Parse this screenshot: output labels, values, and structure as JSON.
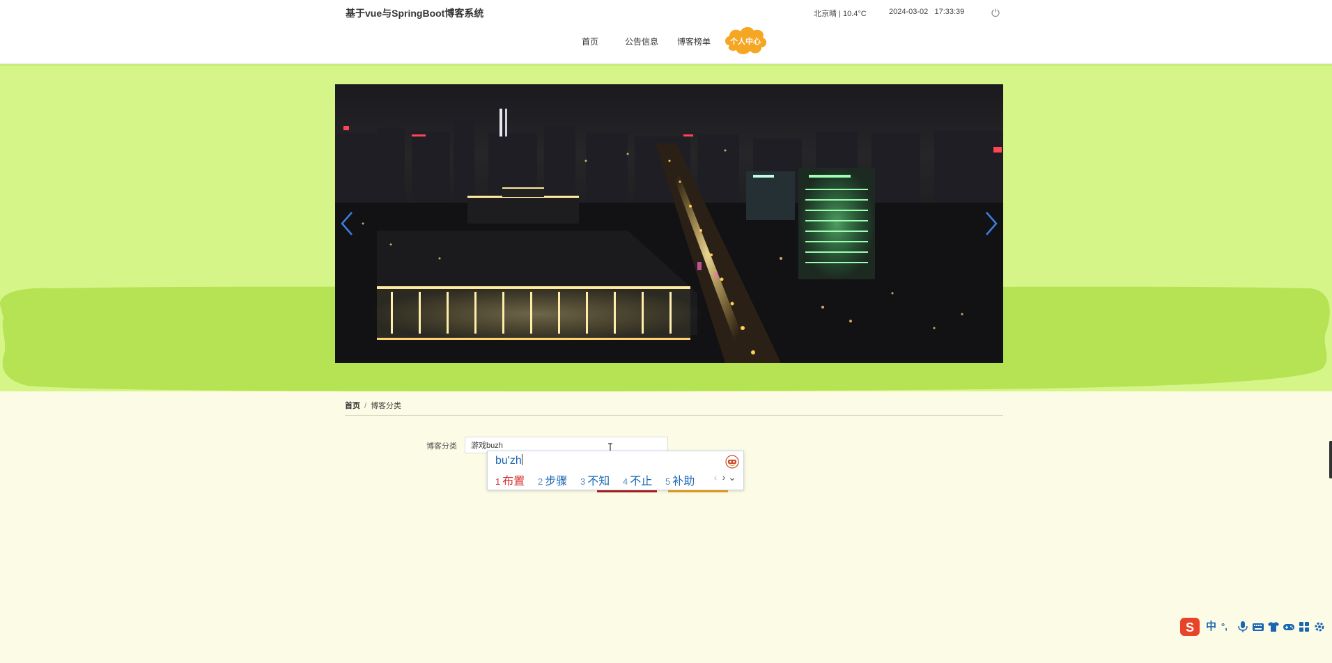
{
  "header": {
    "title": "基于vue与SpringBoot博客系统",
    "weather": "北京晴 | 10.4°C",
    "date": "2024-03-02",
    "time": "17:33:39"
  },
  "nav": {
    "home": "首页",
    "notice": "公告信息",
    "blog_list": "博客榜单",
    "personal": "个人中心"
  },
  "breadcrumb": {
    "home": "首页",
    "separator": "/",
    "current": "博客分类"
  },
  "form": {
    "label": "博客分类",
    "input_value": "游戏buzh"
  },
  "ime": {
    "pinyin": "bu'zh",
    "candidates": [
      {
        "num": "1",
        "text": "布置"
      },
      {
        "num": "2",
        "text": "步骤"
      },
      {
        "num": "3",
        "text": "不知"
      },
      {
        "num": "4",
        "text": "不止"
      },
      {
        "num": "5",
        "text": "补助"
      }
    ],
    "prev": "‹",
    "next": "›",
    "expand": "⌄",
    "toolbar": {
      "lang": "中",
      "punct": "°,"
    }
  },
  "icons": {
    "power": "power-icon",
    "carousel_prev": "chevron-left-icon",
    "carousel_next": "chevron-right-icon",
    "ime_logo": "sogou-logo-icon"
  },
  "colors": {
    "header_bg": "#ffffff",
    "hero_bg": "#d6f589",
    "grass": "#b5e354",
    "page_bg": "#fcfce6",
    "nav_personal": "#f5a623",
    "submit": "#b01e22",
    "reset": "#f0a21c",
    "ime_blue": "#1a66b3",
    "ime_red": "#d63030"
  }
}
